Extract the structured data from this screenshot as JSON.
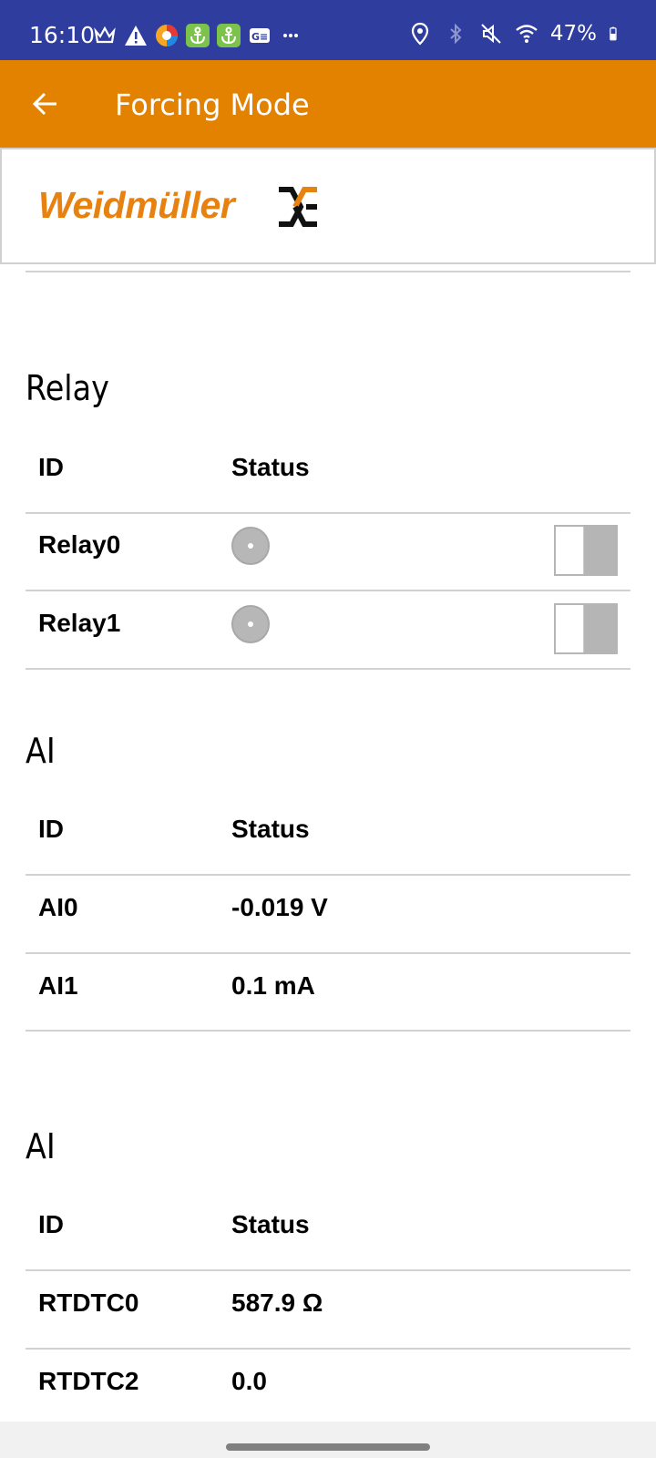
{
  "status_bar": {
    "time": "16:10",
    "battery": "47%",
    "icons_left": [
      "crown-icon",
      "warning-icon",
      "browser-icon",
      "anchor-icon",
      "anchor-icon",
      "news-icon",
      "more-icon"
    ],
    "icons_right": [
      "location-icon",
      "bluetooth-icon",
      "mute-icon",
      "wifi-icon",
      "battery-icon"
    ]
  },
  "app_bar": {
    "title": "Forcing Mode",
    "back_icon": "arrow-left-icon"
  },
  "logo": {
    "text": "Weidmüller"
  },
  "relay_section": {
    "title": "Relay",
    "headers": {
      "id": "ID",
      "status": "Status"
    },
    "rows": [
      {
        "id": "Relay0"
      },
      {
        "id": "Relay1"
      }
    ]
  },
  "ai_section": {
    "title": "AI",
    "headers": {
      "id": "ID",
      "status": "Status"
    },
    "rows": [
      {
        "id": "AI0",
        "status": "-0.019 V"
      },
      {
        "id": "AI1",
        "status": "0.1 mA"
      }
    ]
  },
  "rtd_section": {
    "title": "AI",
    "headers": {
      "id": "ID",
      "status": "Status"
    },
    "rows": [
      {
        "id": "RTDTC0",
        "status": "587.9 Ω"
      },
      {
        "id": "RTDTC2",
        "status": "0.0"
      }
    ]
  },
  "colors": {
    "status_bar": "#2f3d9e",
    "app_bar": "#e38100",
    "brand": "#e78211"
  }
}
